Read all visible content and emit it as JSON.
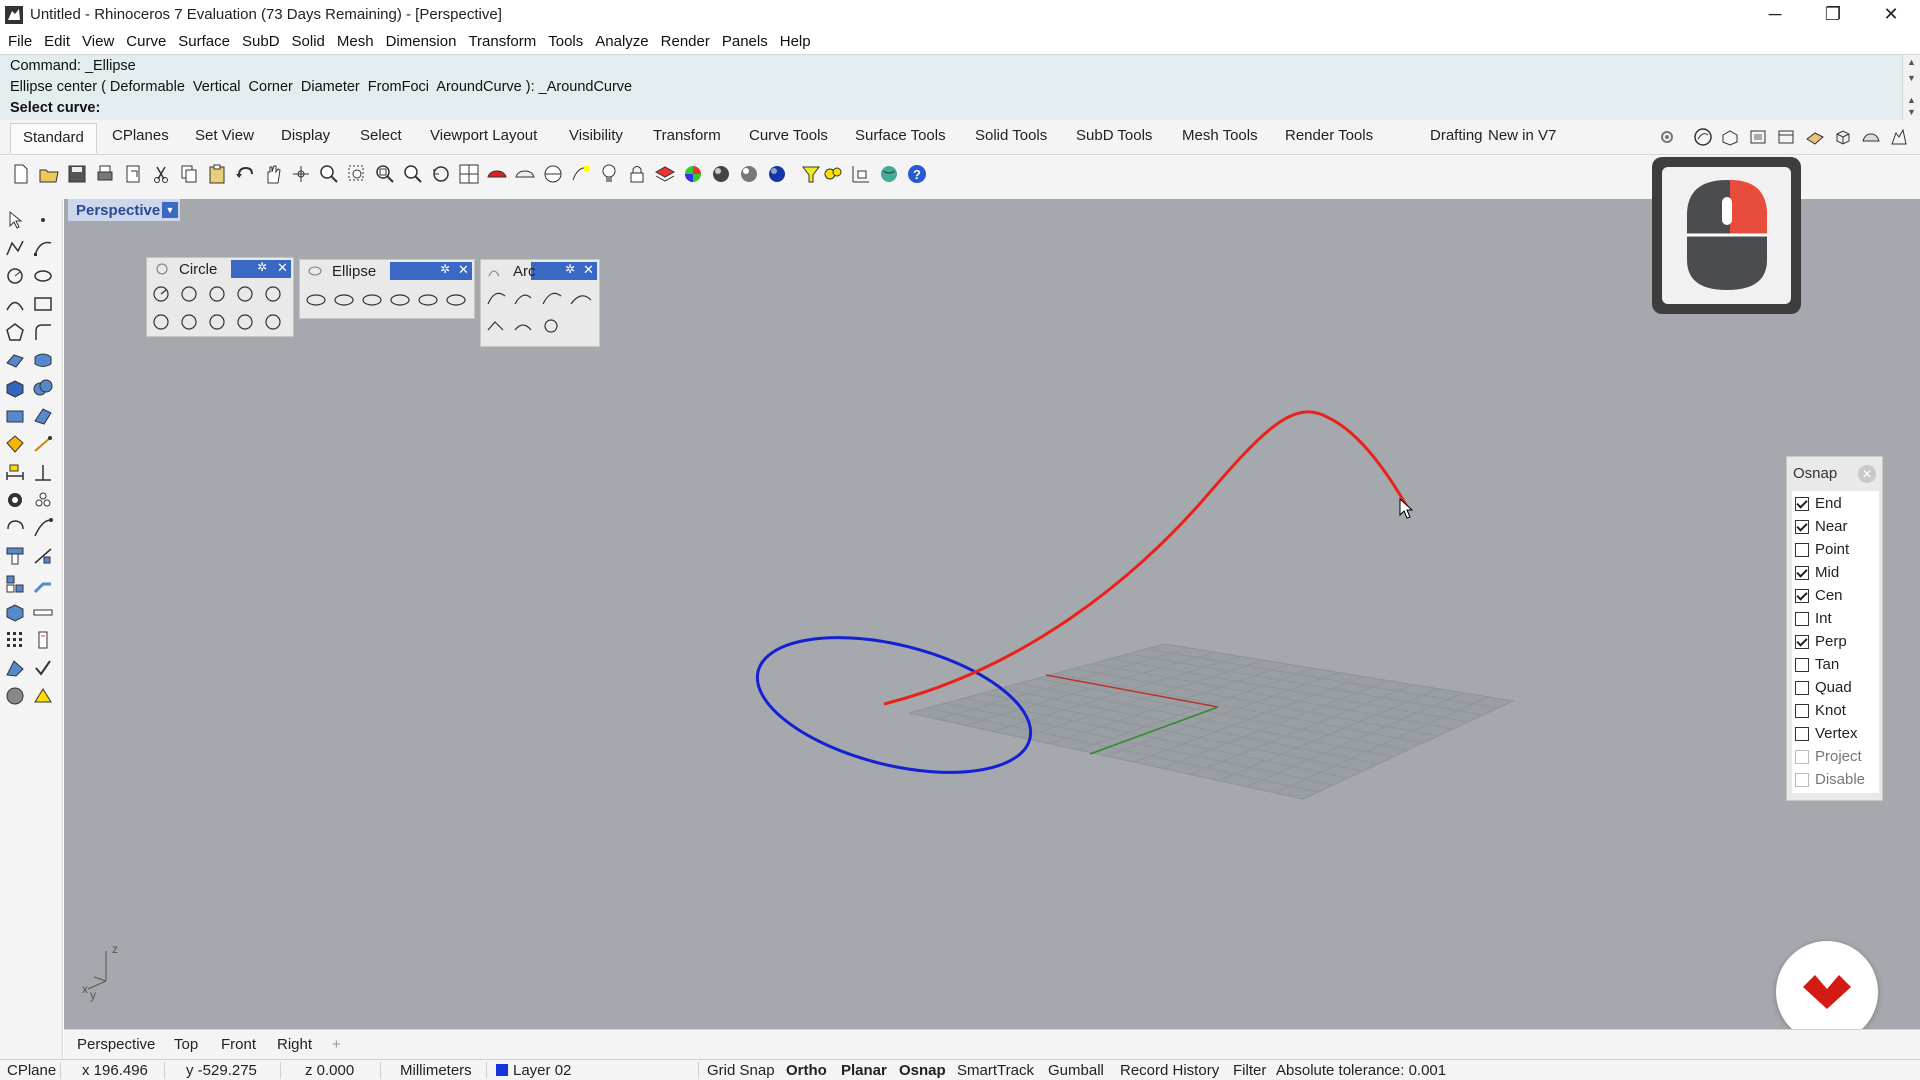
{
  "window": {
    "title": "Untitled - Rhinoceros 7 Evaluation (73 Days Remaining) - [Perspective]",
    "controls": {
      "minimize": "─",
      "restore": "❐",
      "close": "✕"
    }
  },
  "menu": [
    "File",
    "Edit",
    "View",
    "Curve",
    "Surface",
    "SubD",
    "Solid",
    "Mesh",
    "Dimension",
    "Transform",
    "Tools",
    "Analyze",
    "Render",
    "Panels",
    "Help"
  ],
  "command": {
    "history": "Command: _Ellipse",
    "options": "Ellipse center ( Deformable  Vertical  Corner  Diameter  FromFoci  AroundCurve ): _AroundCurve",
    "prompt": "Select curve:"
  },
  "toolbar_tabs": [
    "Standard",
    "CPlanes",
    "Set View",
    "Display",
    "Select",
    "Viewport Layout",
    "Visibility",
    "Transform",
    "Curve Tools",
    "Surface Tools",
    "Solid Tools",
    "SubD Tools",
    "Mesh Tools",
    "Render Tools",
    "Drafting",
    "New in V7"
  ],
  "viewport": {
    "name": "Perspective",
    "dropdown": "▼"
  },
  "panels": {
    "circle": {
      "title": "Circle"
    },
    "ellipse": {
      "title": "Ellipse"
    },
    "arc": {
      "title": "Arc"
    }
  },
  "osnap": {
    "title": "Osnap",
    "items": [
      {
        "label": "End",
        "checked": true,
        "enabled": true
      },
      {
        "label": "Near",
        "checked": true,
        "enabled": true
      },
      {
        "label": "Point",
        "checked": false,
        "enabled": true
      },
      {
        "label": "Mid",
        "checked": true,
        "enabled": true
      },
      {
        "label": "Cen",
        "checked": true,
        "enabled": true
      },
      {
        "label": "Int",
        "checked": false,
        "enabled": true
      },
      {
        "label": "Perp",
        "checked": true,
        "enabled": true
      },
      {
        "label": "Tan",
        "checked": false,
        "enabled": true
      },
      {
        "label": "Quad",
        "checked": false,
        "enabled": true
      },
      {
        "label": "Knot",
        "checked": false,
        "enabled": true
      },
      {
        "label": "Vertex",
        "checked": false,
        "enabled": true
      },
      {
        "label": "Project",
        "checked": false,
        "enabled": false
      },
      {
        "label": "Disable",
        "checked": false,
        "enabled": false
      }
    ]
  },
  "axis_labels": {
    "z": "z",
    "x": "x",
    "y": "y"
  },
  "viewport_tabs": [
    "Perspective",
    "Top",
    "Front",
    "Right",
    "+"
  ],
  "status": {
    "cplane": "CPlane",
    "x": "x 196.496",
    "y": "y -529.275",
    "z": "z 0.000",
    "units": "Millimeters",
    "layer": "Layer 02",
    "layer_color": "#1433d9",
    "grid_snap": "Grid Snap",
    "ortho": "Ortho",
    "planar": "Planar",
    "osnap": "Osnap",
    "smarttrack": "SmartTrack",
    "gumball": "Gumball",
    "record_history": "Record History",
    "filter": "Filter",
    "tolerance": "Absolute tolerance: 0.001"
  },
  "colors": {
    "viewport_bg": "#a5a9ad",
    "curve_red": "#e8221a",
    "ellipse_blue": "#1420d4",
    "accent": "#3a68c5"
  }
}
